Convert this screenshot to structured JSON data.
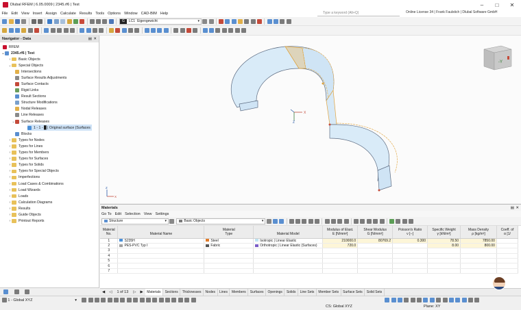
{
  "window": {
    "title": "Dlubal RFEM | 6.05.0009 | 2345.rf6 | Test",
    "controls": [
      "minimize",
      "maximize",
      "close"
    ]
  },
  "menu": {
    "items": [
      "File",
      "Edit",
      "View",
      "Insert",
      "Assign",
      "Calculate",
      "Results",
      "Tools",
      "Options",
      "Window",
      "CAD-BIM",
      "Help"
    ],
    "search_placeholder": "Type a keyword (Alt+Q)",
    "license": "Online License 34 | Frank Faulstich | Dlubal Software GmbH"
  },
  "toolbar": {
    "loadcase_badge": "G",
    "loadcase_code": "LC1",
    "loadcase_name": "Eigengewicht"
  },
  "navigator": {
    "title": "Navigator - Data",
    "root": "RFEM",
    "file": "2345.rf6 | Test",
    "items": [
      {
        "label": "Basic Objects",
        "level": 1,
        "type": "folder",
        "expanded": false
      },
      {
        "label": "Special Objects",
        "level": 1,
        "type": "folder",
        "expanded": true
      },
      {
        "label": "Intersections",
        "level": 2,
        "type": "item",
        "icon": "intersection-icon"
      },
      {
        "label": "Surface Results Adjustments",
        "level": 2,
        "type": "item",
        "icon": "results-adjust-icon"
      },
      {
        "label": "Surface Contacts",
        "level": 2,
        "type": "item",
        "icon": "contact-icon"
      },
      {
        "label": "Rigid Links",
        "level": 2,
        "type": "item",
        "icon": "rigid-link-icon"
      },
      {
        "label": "Result Sections",
        "level": 2,
        "type": "item",
        "icon": "section-icon"
      },
      {
        "label": "Structure Modifications",
        "level": 2,
        "type": "item",
        "icon": "modification-icon"
      },
      {
        "label": "Nodal Releases",
        "level": 2,
        "type": "item",
        "icon": "release-icon"
      },
      {
        "label": "Line Releases",
        "level": 2,
        "type": "item",
        "icon": "release-icon"
      },
      {
        "label": "Surface Releases",
        "level": 2,
        "type": "item",
        "icon": "release-icon",
        "expanded": true
      },
      {
        "label": "1 - 1 - █ | Original surface (Surfaces",
        "level": 3,
        "type": "selected",
        "icon": "surface-icon"
      },
      {
        "label": "Blocks",
        "level": 2,
        "type": "item",
        "icon": "block-icon"
      },
      {
        "label": "Types for Nodes",
        "level": 1,
        "type": "folder",
        "expanded": false
      },
      {
        "label": "Types for Lines",
        "level": 1,
        "type": "folder",
        "expanded": false
      },
      {
        "label": "Types for Members",
        "level": 1,
        "type": "folder",
        "expanded": false
      },
      {
        "label": "Types for Surfaces",
        "level": 1,
        "type": "folder",
        "expanded": false
      },
      {
        "label": "Types for Solids",
        "level": 1,
        "type": "folder",
        "expanded": false
      },
      {
        "label": "Types for Special Objects",
        "level": 1,
        "type": "folder",
        "expanded": false
      },
      {
        "label": "Imperfections",
        "level": 1,
        "type": "folder",
        "expanded": false
      },
      {
        "label": "Load Cases & Combinations",
        "level": 1,
        "type": "folder",
        "expanded": false
      },
      {
        "label": "Load Wizards",
        "level": 1,
        "type": "folder",
        "expanded": false
      },
      {
        "label": "Loads",
        "level": 1,
        "type": "folder",
        "expanded": false
      },
      {
        "label": "Calculation Diagrams",
        "level": 1,
        "type": "folder",
        "expanded": false
      },
      {
        "label": "Results",
        "level": 1,
        "type": "folder",
        "expanded": false
      },
      {
        "label": "Guide Objects",
        "level": 1,
        "type": "folder",
        "expanded": false
      },
      {
        "label": "Printout Reports",
        "level": 1,
        "type": "folder",
        "expanded": false
      }
    ]
  },
  "viewport": {
    "cube_face": "-Y",
    "axis_x": "X",
    "axis_y": "Y",
    "axis_z": "Z"
  },
  "materials": {
    "title": "Materials",
    "menu": [
      "Go To",
      "Edit",
      "Selection",
      "View",
      "Settings"
    ],
    "filter": "Structure",
    "category": "Basic Objects",
    "columns": [
      {
        "line1": "Material",
        "line2": "No."
      },
      {
        "line1": "",
        "line2": "Material Name"
      },
      {
        "line1": "Material",
        "line2": "Type"
      },
      {
        "line1": "",
        "line2": "Material Model"
      },
      {
        "line1": "Modulus of Elast.",
        "line2": "E [N/mm²]"
      },
      {
        "line1": "Shear Modulus",
        "line2": "G [N/mm²]"
      },
      {
        "line1": "Poisson's Ratio",
        "line2": "ν [--]"
      },
      {
        "line1": "Specific Weight",
        "line2": "γ [kN/m³]"
      },
      {
        "line1": "Mass Density",
        "line2": "ρ [kg/m³]"
      },
      {
        "line1": "Coeff. of",
        "line2": "α [1/"
      }
    ],
    "rows": [
      {
        "no": "1",
        "name": "S235H",
        "name_color": "#4a8fd8",
        "type": "Steel",
        "type_color": "#e07b2a",
        "model": "Isotropic | Linear Elastic",
        "model_color": "#bfe3f2",
        "e": "210000.0",
        "g": "80769.2",
        "nu": "0.300",
        "gamma": "78.50",
        "rho": "7850.00",
        "alpha": ""
      },
      {
        "no": "2",
        "name": "PES-PVC Typ I",
        "name_color": "#a0a0a0",
        "type": "Fabric",
        "type_color": "#555555",
        "model": "Orthotropic | Linear Elastic (Surfaces)",
        "model_color": "#7a5cc7",
        "e": "720.0",
        "g": "",
        "nu": "",
        "gamma": "8.00",
        "rho": "800.00",
        "alpha": ""
      },
      {
        "no": "3",
        "name": "",
        "type": "",
        "model": "",
        "e": "",
        "g": "",
        "nu": "",
        "gamma": "",
        "rho": "",
        "alpha": ""
      },
      {
        "no": "4",
        "name": "",
        "type": "",
        "model": "",
        "e": "",
        "g": "",
        "nu": "",
        "gamma": "",
        "rho": "",
        "alpha": ""
      },
      {
        "no": "5",
        "name": "",
        "type": "",
        "model": "",
        "e": "",
        "g": "",
        "nu": "",
        "gamma": "",
        "rho": "",
        "alpha": ""
      },
      {
        "no": "6",
        "name": "",
        "type": "",
        "model": "",
        "e": "",
        "g": "",
        "nu": "",
        "gamma": "",
        "rho": "",
        "alpha": ""
      },
      {
        "no": "7",
        "name": "",
        "type": "",
        "model": "",
        "e": "",
        "g": "",
        "nu": "",
        "gamma": "",
        "rho": "",
        "alpha": ""
      }
    ],
    "pager": "1 of 13",
    "tabs": [
      "Materials",
      "Sections",
      "Thicknesses",
      "Nodes",
      "Lines",
      "Members",
      "Surfaces",
      "Openings",
      "Solids",
      "Line Sets",
      "Member Sets",
      "Surface Sets",
      "Solid Sets"
    ],
    "active_tab": "Materials"
  },
  "status": {
    "coord_system": "1 - Global XYZ",
    "cs": "CS: Global XYZ",
    "plane": "Plane: XY"
  },
  "colors": {
    "accent": "#1e6fc4",
    "selection": "#cfe3f7",
    "structure_fill": "#d7e9f7",
    "structure_edge": "#e0a23a",
    "structure_outline": "#5b6a80"
  }
}
